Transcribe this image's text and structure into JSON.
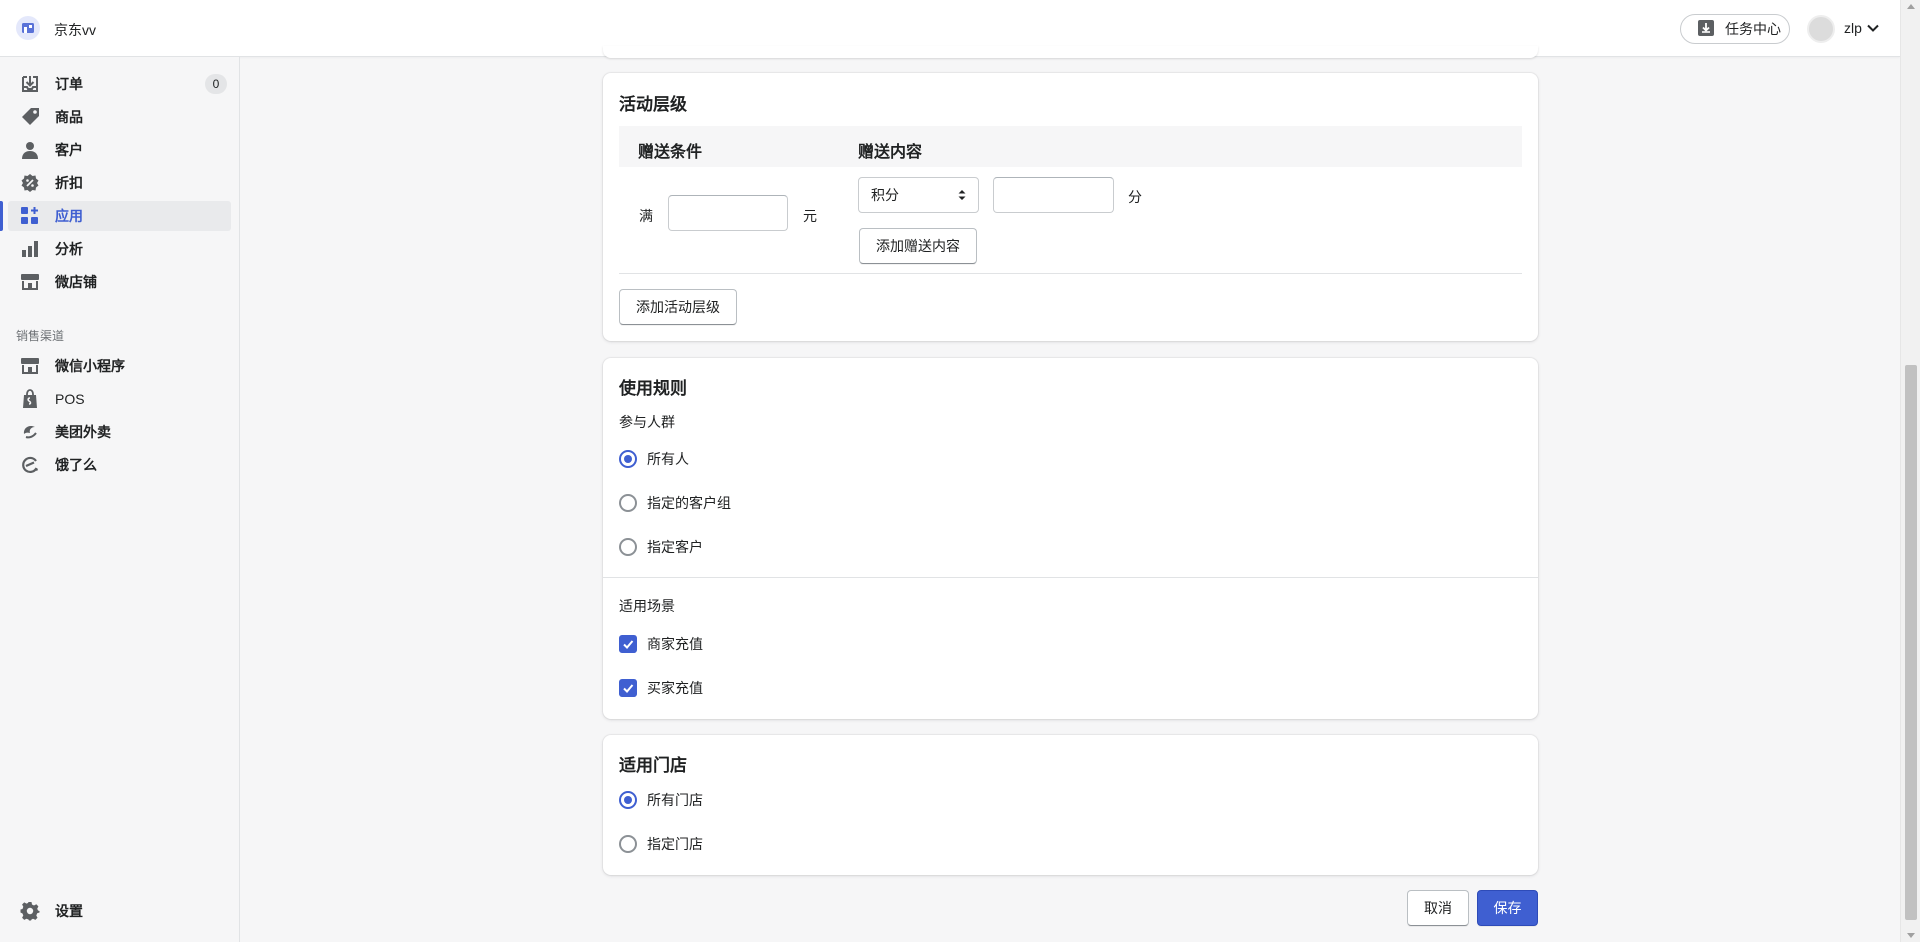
{
  "header": {
    "store_name": "京东vv",
    "task_center_label": "任务中心",
    "user_name": "zlp"
  },
  "sidebar": {
    "items": [
      {
        "label": "订单",
        "icon": "order-download-icon",
        "badge": "0"
      },
      {
        "label": "商品",
        "icon": "tag-icon"
      },
      {
        "label": "客户",
        "icon": "person-icon"
      },
      {
        "label": "折扣",
        "icon": "discount-icon"
      },
      {
        "label": "应用",
        "icon": "apps-icon",
        "active": true
      },
      {
        "label": "分析",
        "icon": "bar-chart-icon"
      },
      {
        "label": "微店铺",
        "icon": "storefront-icon"
      }
    ],
    "channels_label": "销售渠道",
    "channels": [
      {
        "label": "微信小程序",
        "icon": "storefront-icon"
      },
      {
        "label": "POS",
        "icon": "shopping-bag-icon"
      },
      {
        "label": "美团外卖",
        "icon": "meituan-icon"
      },
      {
        "label": "饿了么",
        "icon": "eleme-icon"
      }
    ],
    "settings_label": "设置"
  },
  "tiers_card": {
    "title": "活动层级",
    "col_condition": "赠送条件",
    "col_content": "赠送内容",
    "prefix_full": "满",
    "unit_yuan": "元",
    "gift_type_selected": "积分",
    "unit_points": "分",
    "add_gift_label": "添加赠送内容",
    "add_tier_label": "添加活动层级"
  },
  "rules_card": {
    "title": "使用规则",
    "audience_label": "参与人群",
    "audience_options": [
      {
        "label": "所有人",
        "selected": true
      },
      {
        "label": "指定的客户组",
        "selected": false
      },
      {
        "label": "指定客户",
        "selected": false
      }
    ],
    "scene_label": "适用场景",
    "scene_options": [
      {
        "label": "商家充值",
        "checked": true
      },
      {
        "label": "买家充值",
        "checked": true
      }
    ]
  },
  "stores_card": {
    "title": "适用门店",
    "options": [
      {
        "label": "所有门店",
        "selected": true
      },
      {
        "label": "指定门店",
        "selected": false
      }
    ]
  },
  "footer": {
    "cancel_label": "取消",
    "save_label": "保存"
  },
  "colors": {
    "accent": "#3f5fd1",
    "text": "#202223",
    "border": "#c9cccf",
    "background": "#f6f6f7"
  }
}
